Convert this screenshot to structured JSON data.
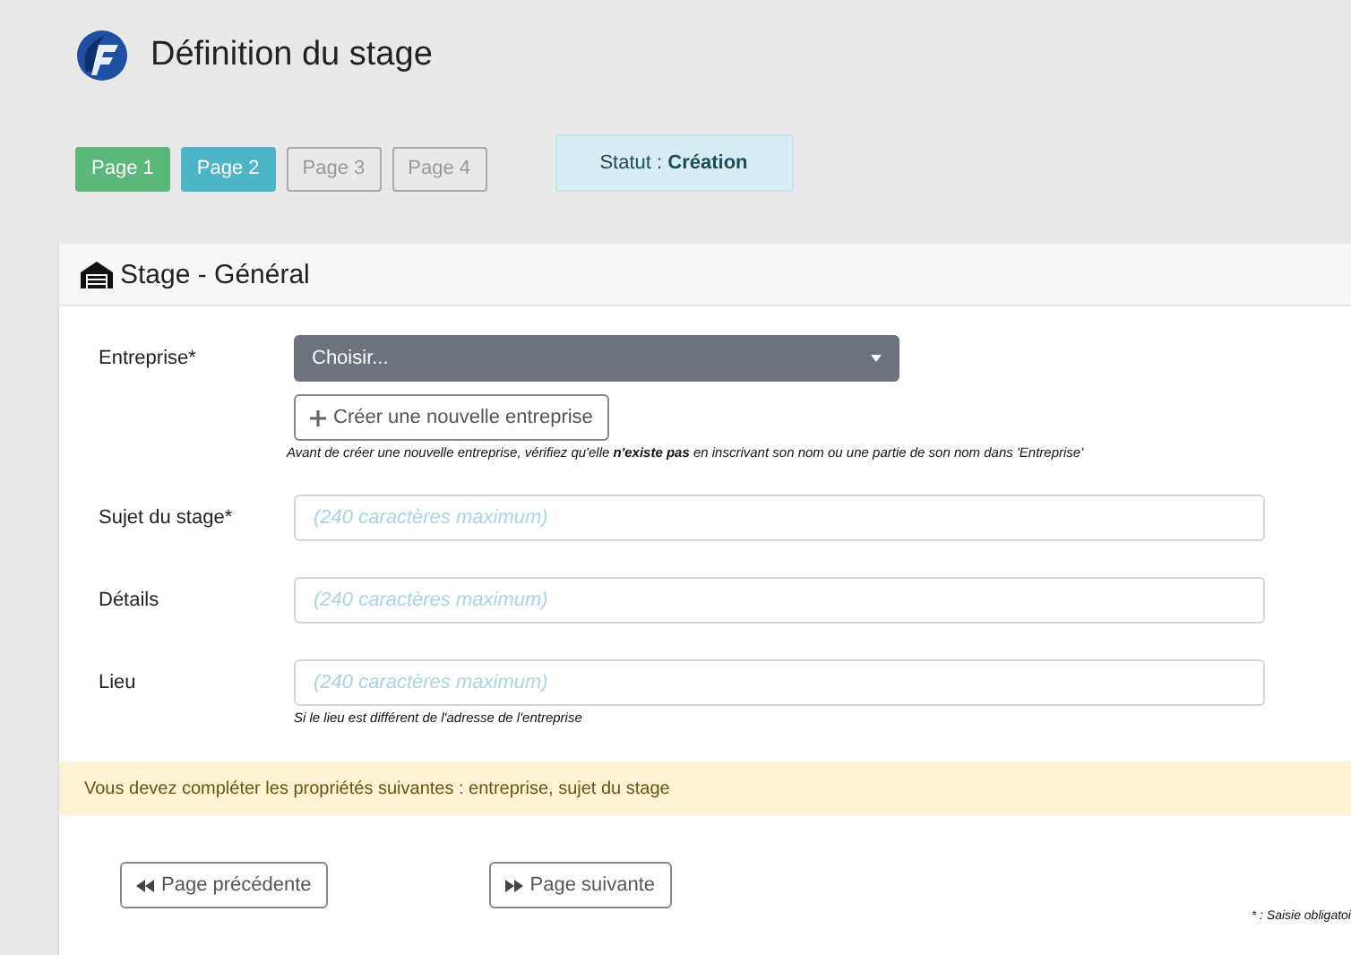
{
  "header": {
    "title": "Définition du stage"
  },
  "pages": [
    {
      "label": "Page 1",
      "kind": "done"
    },
    {
      "label": "Page 2",
      "kind": "current"
    },
    {
      "label": "Page 3",
      "kind": "pending"
    },
    {
      "label": "Page 4",
      "kind": "pending"
    }
  ],
  "status": {
    "text": "Statut : **Création**"
  },
  "panel": {
    "title": "Stage - Général",
    "company": {
      "label": "Entreprise*",
      "select_value": "Choisir...",
      "create_button": "Créer une nouvelle entreprise",
      "hint": "Avant de créer une nouvelle entreprise, vérifiez qu'elle **n'existe pas** en inscrivant son nom ou une partie de son nom dans 'Entreprise'"
    },
    "fields": [
      {
        "label": "Sujet du stage*",
        "placeholder": "(240 caractères maximum)"
      },
      {
        "label": "Détails",
        "placeholder": "(240 caractères maximum)"
      },
      {
        "label": "Lieu",
        "placeholder": "(240 caractères maximum)",
        "hint": "Si le lieu est différent de l'adresse de l'entreprise"
      }
    ],
    "alert": "Vous devez compléter les propriétés suivantes : entreprise, sujet du stage",
    "prev_button": "Page précédente",
    "next_button": "Page suivante",
    "footnote": "* : Saisie obligatoi"
  }
}
